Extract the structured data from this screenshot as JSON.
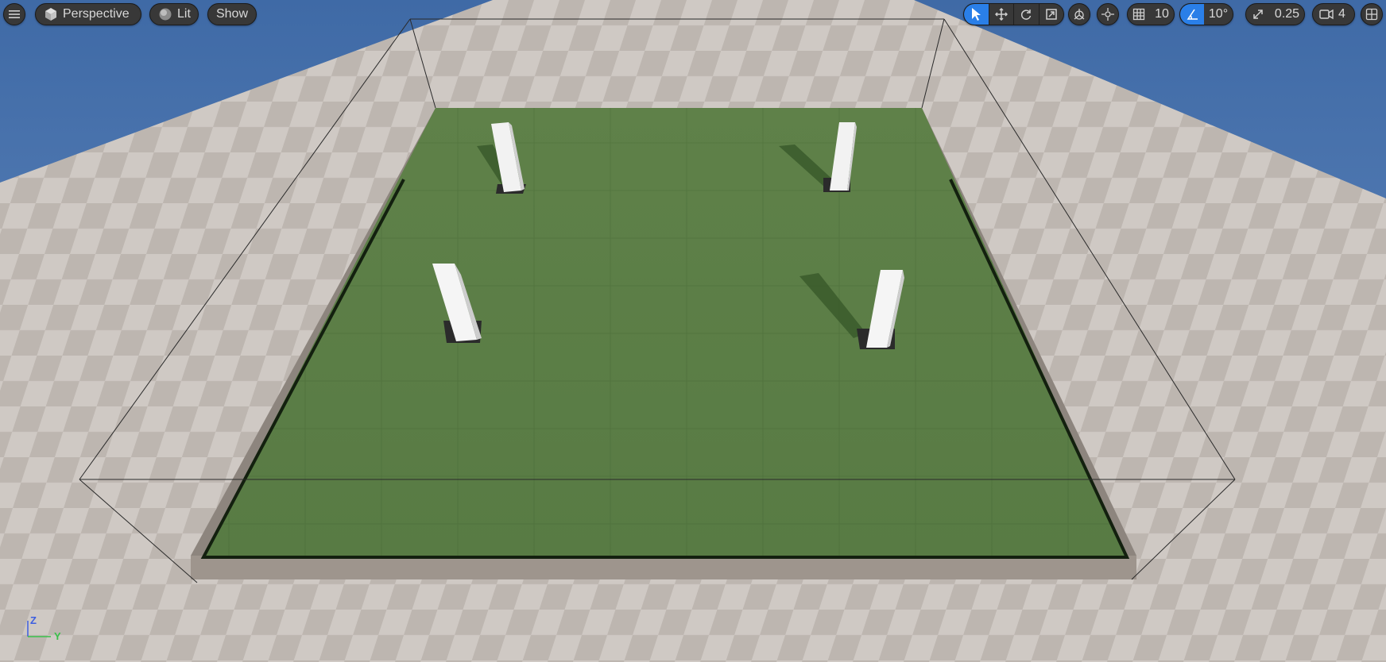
{
  "viewport": {
    "mode_label": "Perspective",
    "lighting_label": "Lit",
    "show_label": "Show",
    "grid_snap_value": "10",
    "rotation_snap_value": "10°",
    "scale_snap_value": "0.25",
    "camera_speed_value": "4",
    "axis_labels": {
      "z": "Z",
      "y": "Y"
    },
    "icons": {
      "menu": "hamburger-menu-icon",
      "perspective": "cube-icon",
      "lit": "sphere-icon",
      "select": "cursor-arrow-icon",
      "translate": "move-arrows-icon",
      "rotate": "rotate-icon",
      "scale": "scale-icon",
      "coord_space": "world-globe-icon",
      "surface_snap": "surface-snap-icon",
      "grid_snap": "grid-icon",
      "rotation_snap": "angle-icon",
      "scale_snap": "diagonal-arrows-icon",
      "camera_speed": "video-camera-icon",
      "layout": "viewport-layout-icon"
    },
    "colors": {
      "toolbar_bg": "#383838",
      "accent_active": "#2a7fe8",
      "floor_green": "#5c7f47",
      "sky_blue": "#4d79b0",
      "axis_z": "#3d5ee0",
      "axis_y": "#39c04a"
    }
  }
}
